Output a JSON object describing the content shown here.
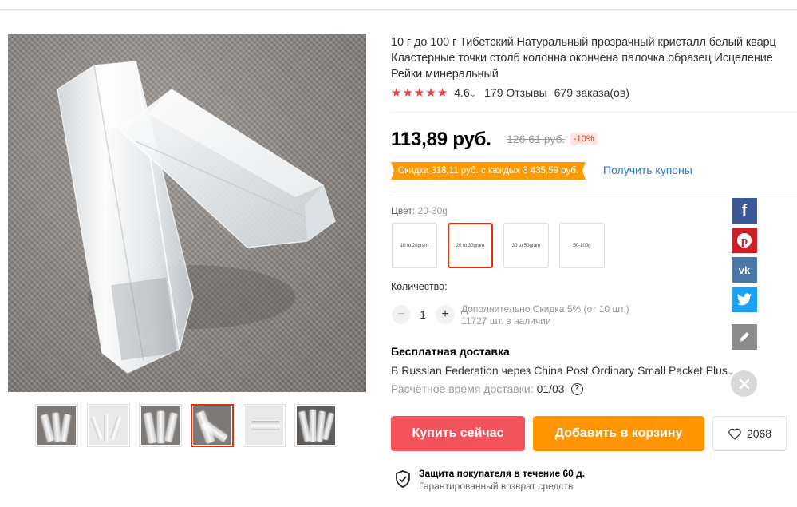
{
  "product": {
    "title": "10 г до 100 г Тибетский Натуральный прозрачный кристалл белый кварц Кластерные точки столб колонна окончена палочка образец Исцеление Рейки минеральный",
    "rating": "4.6",
    "reviews": "179 Отзывы",
    "orders": "679 заказа(ов)",
    "price": "113,89 руб.",
    "old_price": "126,61 руб.",
    "discount": "-10%",
    "coupon_text": "Скидка 318,11 руб. с каждых 3 435,59 руб.",
    "get_coupons": "Получить купоны"
  },
  "variants": {
    "label": "Цвет:",
    "selected_value": "20-30g",
    "options": [
      "10 to 20gram",
      "20 to 30gram",
      "30 to 50gram",
      "50-100g"
    ]
  },
  "quantity": {
    "label": "Количество:",
    "value": "1",
    "minus": "−",
    "plus": "+",
    "extra_discount": "Дополнительно Скидка 5% (от 10 шт.)",
    "stock": "11727 шт. в наличии"
  },
  "shipping": {
    "title": "Бесплатная доставка",
    "method": "В Russian Federation через China Post Ordinary Small Packet Plus",
    "eta_label": "Расчётное время доставки:",
    "eta_value": "01/03"
  },
  "actions": {
    "buy_now": "Купить сейчас",
    "add_to_cart": "Добавить в корзину",
    "wishlist_count": "2068"
  },
  "protection": {
    "title": "Защита покупателя в течение 60 д.",
    "subtitle": "Гарантированный возврат средств"
  },
  "share": {
    "icons": [
      "facebook-icon",
      "pinterest-icon",
      "vk-icon",
      "twitter-icon"
    ]
  },
  "gallery": {
    "thumbnail_count": 6,
    "active_index": 3
  },
  "colors": {
    "accent_red": "#f2525a",
    "cart_orange": "#ff9500",
    "coupon_orange": "#ff9a00",
    "star_red": "#f0404a",
    "link_blue": "#2b7acd"
  }
}
